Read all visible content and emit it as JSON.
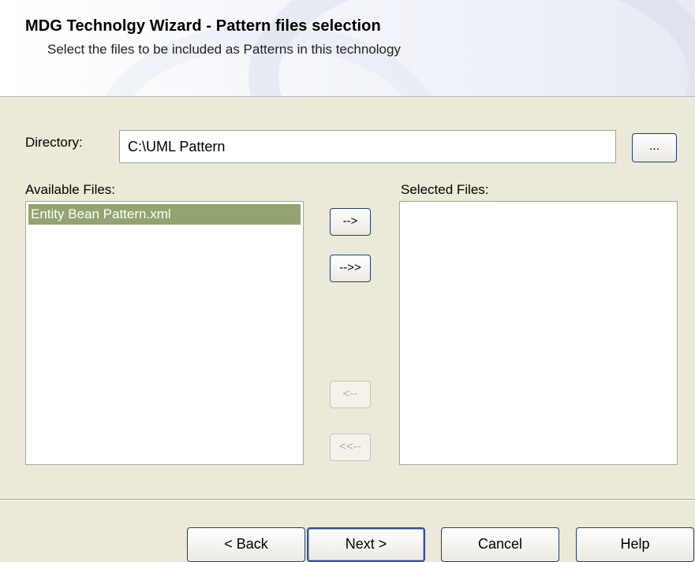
{
  "wizard": {
    "title": "MDG Technolgy Wizard - Pattern files selection",
    "subtitle": "Select the files to be included as Patterns in this technology"
  },
  "directory": {
    "label": "Directory:",
    "value": "C:\\UML Pattern",
    "browse_label": "..."
  },
  "available": {
    "label": "Available Files:",
    "items": [
      "Entity Bean Pattern.xml"
    ]
  },
  "selected": {
    "label": "Selected Files:",
    "items": []
  },
  "transfer": {
    "add": "-->",
    "add_all": "-->>",
    "remove": "<--",
    "remove_all": "<<--"
  },
  "footer": {
    "back": "< Back",
    "next": "Next >",
    "cancel": "Cancel",
    "help": "Help"
  }
}
